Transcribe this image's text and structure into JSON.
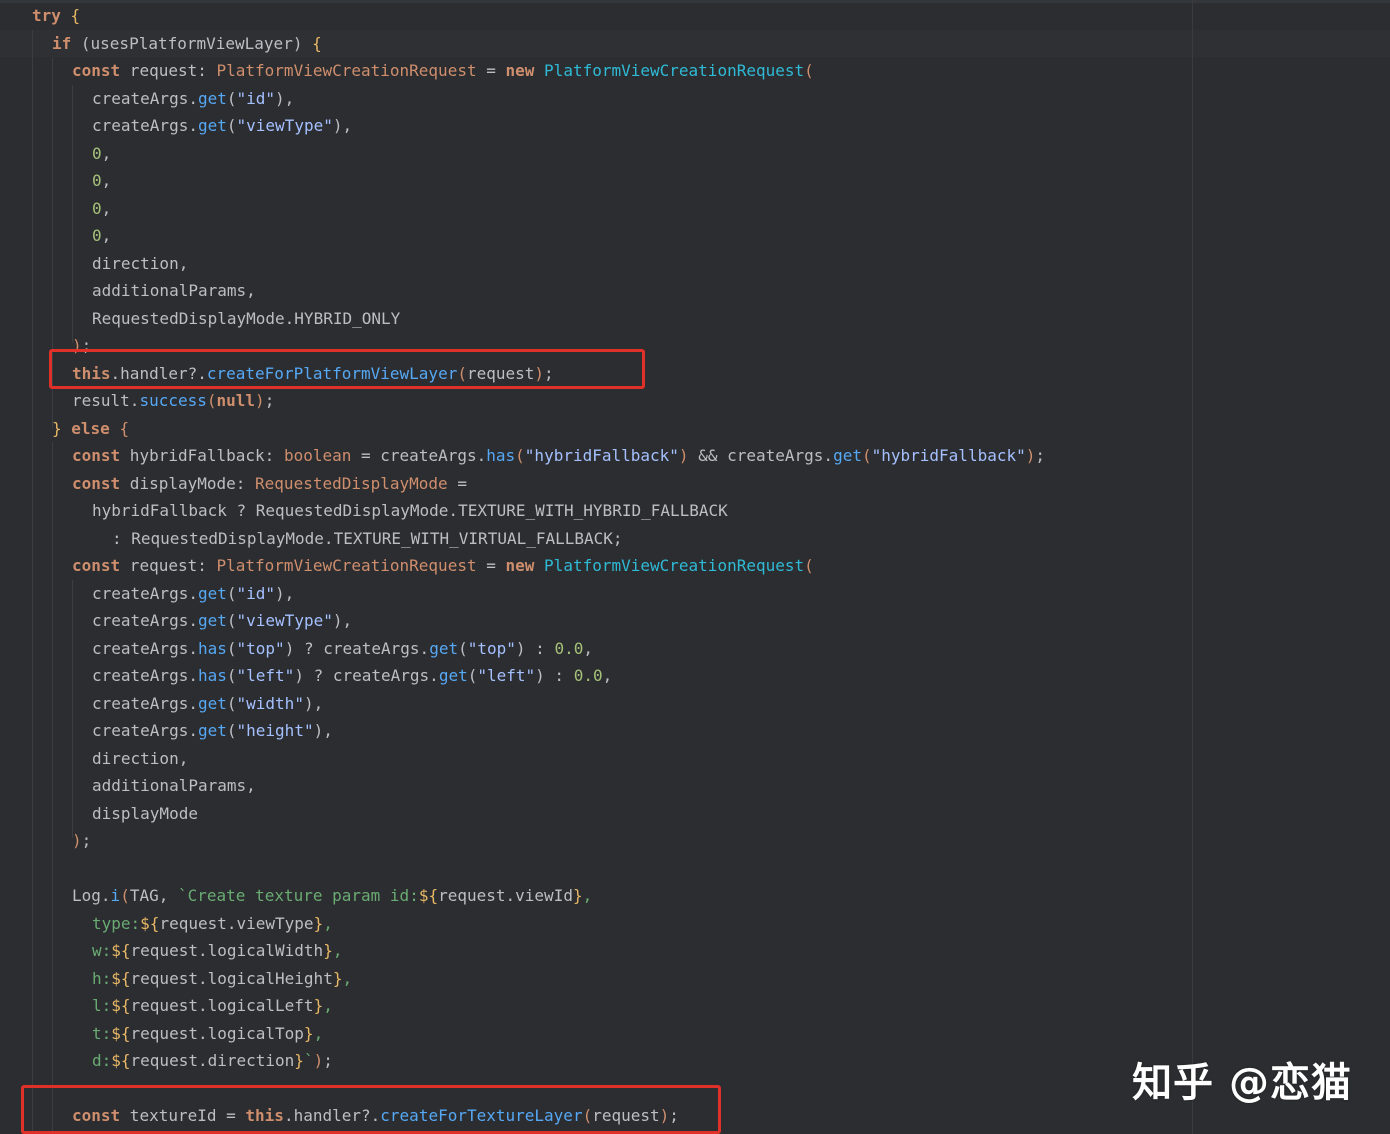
{
  "editor": {
    "colors": {
      "background": "#2b2d30",
      "keyword": "#cf8e6d",
      "type": "#c77dbb",
      "class": "#2fbad6",
      "method": "#56a8f5",
      "string": "#a5c0ff",
      "number": "#a6c17a",
      "highlight_box": "#e0302a"
    },
    "lines": [
      {
        "i": 0,
        "t": [
          [
            "kw",
            "try"
          ],
          [
            "pun",
            " "
          ],
          [
            "brk",
            "{"
          ]
        ]
      },
      {
        "i": 1,
        "t": [
          [
            "kw",
            "if"
          ],
          [
            "pun",
            " ("
          ],
          [
            "var",
            "usesPlatformViewLayer"
          ],
          [
            "pun",
            ") "
          ],
          [
            "brk",
            "{"
          ]
        ]
      },
      {
        "i": 2,
        "t": [
          [
            "kw",
            "const"
          ],
          [
            "var",
            " request"
          ],
          [
            "pun",
            ": "
          ],
          [
            "kwp",
            "PlatformViewCreationRequest"
          ],
          [
            "pun",
            " = "
          ],
          [
            "kw",
            "new"
          ],
          [
            "pun",
            " "
          ],
          [
            "cls",
            "PlatformViewCreationRequest"
          ],
          [
            "kwp",
            "("
          ]
        ]
      },
      {
        "i": 3,
        "t": [
          [
            "var",
            "createArgs"
          ],
          [
            "pun",
            "."
          ],
          [
            "fn",
            "get"
          ],
          [
            "pun",
            "("
          ],
          [
            "str",
            "\"id\""
          ],
          [
            "pun",
            "),"
          ]
        ]
      },
      {
        "i": 3,
        "t": [
          [
            "var",
            "createArgs"
          ],
          [
            "pun",
            "."
          ],
          [
            "fn",
            "get"
          ],
          [
            "pun",
            "("
          ],
          [
            "str",
            "\"viewType\""
          ],
          [
            "pun",
            "),"
          ]
        ]
      },
      {
        "i": 3,
        "t": [
          [
            "num",
            "0"
          ],
          [
            "pun",
            ","
          ]
        ]
      },
      {
        "i": 3,
        "t": [
          [
            "num",
            "0"
          ],
          [
            "pun",
            ","
          ]
        ]
      },
      {
        "i": 3,
        "t": [
          [
            "num",
            "0"
          ],
          [
            "pun",
            ","
          ]
        ]
      },
      {
        "i": 3,
        "t": [
          [
            "num",
            "0"
          ],
          [
            "pun",
            ","
          ]
        ]
      },
      {
        "i": 3,
        "t": [
          [
            "var",
            "direction"
          ],
          [
            "pun",
            ","
          ]
        ]
      },
      {
        "i": 3,
        "t": [
          [
            "var",
            "additionalParams"
          ],
          [
            "pun",
            ","
          ]
        ]
      },
      {
        "i": 3,
        "t": [
          [
            "var",
            "RequestedDisplayMode"
          ],
          [
            "pun",
            "."
          ],
          [
            "var",
            "HYBRID_ONLY"
          ]
        ]
      },
      {
        "i": 2,
        "t": [
          [
            "kwp",
            ")"
          ],
          [
            "pun",
            ";"
          ]
        ]
      },
      {
        "i": 2,
        "t": [
          [
            "kw",
            "this"
          ],
          [
            "pun",
            "."
          ],
          [
            "var",
            "handler"
          ],
          [
            "pun",
            "?."
          ],
          [
            "fn",
            "createForPlatformViewLayer"
          ],
          [
            "kwp",
            "("
          ],
          [
            "var",
            "request"
          ],
          [
            "kwp",
            ")"
          ],
          [
            "pun",
            ";"
          ]
        ]
      },
      {
        "i": 2,
        "t": [
          [
            "var",
            "result"
          ],
          [
            "pun",
            "."
          ],
          [
            "fn",
            "success"
          ],
          [
            "kwp",
            "("
          ],
          [
            "kw",
            "null"
          ],
          [
            "kwp",
            ")"
          ],
          [
            "pun",
            ";"
          ]
        ]
      },
      {
        "i": 1,
        "t": [
          [
            "brk",
            "}"
          ],
          [
            "pun",
            " "
          ],
          [
            "kw",
            "else"
          ],
          [
            "pun",
            " "
          ],
          [
            "kwp",
            "{"
          ]
        ]
      },
      {
        "i": 2,
        "t": [
          [
            "kw",
            "const"
          ],
          [
            "var",
            " hybridFallback"
          ],
          [
            "pun",
            ": "
          ],
          [
            "kwp",
            "boolean"
          ],
          [
            "pun",
            " = "
          ],
          [
            "var",
            "createArgs"
          ],
          [
            "pun",
            "."
          ],
          [
            "fn",
            "has"
          ],
          [
            "kwp",
            "("
          ],
          [
            "str",
            "\"hybridFallback\""
          ],
          [
            "kwp",
            ")"
          ],
          [
            "pun",
            " && "
          ],
          [
            "var",
            "createArgs"
          ],
          [
            "pun",
            "."
          ],
          [
            "fn",
            "get"
          ],
          [
            "kwp",
            "("
          ],
          [
            "str",
            "\"hybridFallback\""
          ],
          [
            "kwp",
            ")"
          ],
          [
            "pun",
            ";"
          ]
        ]
      },
      {
        "i": 2,
        "t": [
          [
            "kw",
            "const"
          ],
          [
            "var",
            " displayMode"
          ],
          [
            "pun",
            ": "
          ],
          [
            "kwp",
            "RequestedDisplayMode"
          ],
          [
            "pun",
            " ="
          ]
        ]
      },
      {
        "i": 3,
        "t": [
          [
            "var",
            "hybridFallback"
          ],
          [
            "pun",
            " ? "
          ],
          [
            "var",
            "RequestedDisplayMode"
          ],
          [
            "pun",
            "."
          ],
          [
            "var",
            "TEXTURE_WITH_HYBRID_FALLBACK"
          ]
        ]
      },
      {
        "i": 4,
        "t": [
          [
            "pun",
            ": "
          ],
          [
            "var",
            "RequestedDisplayMode"
          ],
          [
            "pun",
            "."
          ],
          [
            "var",
            "TEXTURE_WITH_VIRTUAL_FALLBACK"
          ],
          [
            "pun",
            ";"
          ]
        ]
      },
      {
        "i": 2,
        "t": [
          [
            "kw",
            "const"
          ],
          [
            "var",
            " request"
          ],
          [
            "pun",
            ": "
          ],
          [
            "kwp",
            "PlatformViewCreationRequest"
          ],
          [
            "pun",
            " = "
          ],
          [
            "kw",
            "new"
          ],
          [
            "pun",
            " "
          ],
          [
            "cls",
            "PlatformViewCreationRequest"
          ],
          [
            "kwp",
            "("
          ]
        ]
      },
      {
        "i": 3,
        "t": [
          [
            "var",
            "createArgs"
          ],
          [
            "pun",
            "."
          ],
          [
            "fn",
            "get"
          ],
          [
            "pun",
            "("
          ],
          [
            "str",
            "\"id\""
          ],
          [
            "pun",
            "),"
          ]
        ]
      },
      {
        "i": 3,
        "t": [
          [
            "var",
            "createArgs"
          ],
          [
            "pun",
            "."
          ],
          [
            "fn",
            "get"
          ],
          [
            "pun",
            "("
          ],
          [
            "str",
            "\"viewType\""
          ],
          [
            "pun",
            "),"
          ]
        ]
      },
      {
        "i": 3,
        "t": [
          [
            "var",
            "createArgs"
          ],
          [
            "pun",
            "."
          ],
          [
            "fn",
            "has"
          ],
          [
            "pun",
            "("
          ],
          [
            "str",
            "\"top\""
          ],
          [
            "pun",
            ") ? "
          ],
          [
            "var",
            "createArgs"
          ],
          [
            "pun",
            "."
          ],
          [
            "fn",
            "get"
          ],
          [
            "pun",
            "("
          ],
          [
            "str",
            "\"top\""
          ],
          [
            "pun",
            ") : "
          ],
          [
            "num",
            "0.0"
          ],
          [
            "pun",
            ","
          ]
        ]
      },
      {
        "i": 3,
        "t": [
          [
            "var",
            "createArgs"
          ],
          [
            "pun",
            "."
          ],
          [
            "fn",
            "has"
          ],
          [
            "pun",
            "("
          ],
          [
            "str",
            "\"left\""
          ],
          [
            "pun",
            ") ? "
          ],
          [
            "var",
            "createArgs"
          ],
          [
            "pun",
            "."
          ],
          [
            "fn",
            "get"
          ],
          [
            "pun",
            "("
          ],
          [
            "str",
            "\"left\""
          ],
          [
            "pun",
            ") : "
          ],
          [
            "num",
            "0.0"
          ],
          [
            "pun",
            ","
          ]
        ]
      },
      {
        "i": 3,
        "t": [
          [
            "var",
            "createArgs"
          ],
          [
            "pun",
            "."
          ],
          [
            "fn",
            "get"
          ],
          [
            "pun",
            "("
          ],
          [
            "str",
            "\"width\""
          ],
          [
            "pun",
            "),"
          ]
        ]
      },
      {
        "i": 3,
        "t": [
          [
            "var",
            "createArgs"
          ],
          [
            "pun",
            "."
          ],
          [
            "fn",
            "get"
          ],
          [
            "pun",
            "("
          ],
          [
            "str",
            "\"height\""
          ],
          [
            "pun",
            "),"
          ]
        ]
      },
      {
        "i": 3,
        "t": [
          [
            "var",
            "direction"
          ],
          [
            "pun",
            ","
          ]
        ]
      },
      {
        "i": 3,
        "t": [
          [
            "var",
            "additionalParams"
          ],
          [
            "pun",
            ","
          ]
        ]
      },
      {
        "i": 3,
        "t": [
          [
            "var",
            "displayMode"
          ]
        ]
      },
      {
        "i": 2,
        "t": [
          [
            "kwp",
            ")"
          ],
          [
            "pun",
            ";"
          ]
        ]
      },
      {
        "i": 2,
        "t": []
      },
      {
        "i": 2,
        "t": [
          [
            "var",
            "Log"
          ],
          [
            "pun",
            "."
          ],
          [
            "fn",
            "i"
          ],
          [
            "kwp",
            "("
          ],
          [
            "var",
            "TAG"
          ],
          [
            "pun",
            ", "
          ],
          [
            "tpl",
            "`Create texture param id:"
          ],
          [
            "brk",
            "${"
          ],
          [
            "var",
            "request.viewId"
          ],
          [
            "brk",
            "}"
          ],
          [
            "tpl",
            ","
          ]
        ]
      },
      {
        "i": 3,
        "t": [
          [
            "tpl",
            "type:"
          ],
          [
            "brk",
            "${"
          ],
          [
            "var",
            "request.viewType"
          ],
          [
            "brk",
            "}"
          ],
          [
            "tpl",
            ","
          ]
        ]
      },
      {
        "i": 3,
        "t": [
          [
            "tpl",
            "w:"
          ],
          [
            "brk",
            "${"
          ],
          [
            "var",
            "request.logicalWidth"
          ],
          [
            "brk",
            "}"
          ],
          [
            "tpl",
            ","
          ]
        ]
      },
      {
        "i": 3,
        "t": [
          [
            "tpl",
            "h:"
          ],
          [
            "brk",
            "${"
          ],
          [
            "var",
            "request.logicalHeight"
          ],
          [
            "brk",
            "}"
          ],
          [
            "tpl",
            ","
          ]
        ]
      },
      {
        "i": 3,
        "t": [
          [
            "tpl",
            "l:"
          ],
          [
            "brk",
            "${"
          ],
          [
            "var",
            "request.logicalLeft"
          ],
          [
            "brk",
            "}"
          ],
          [
            "tpl",
            ","
          ]
        ]
      },
      {
        "i": 3,
        "t": [
          [
            "tpl",
            "t:"
          ],
          [
            "brk",
            "${"
          ],
          [
            "var",
            "request.logicalTop"
          ],
          [
            "brk",
            "}"
          ],
          [
            "tpl",
            ","
          ]
        ]
      },
      {
        "i": 3,
        "t": [
          [
            "tpl",
            "d:"
          ],
          [
            "brk",
            "${"
          ],
          [
            "var",
            "request.direction"
          ],
          [
            "brk",
            "}"
          ],
          [
            "tpl",
            "`"
          ],
          [
            "kwp",
            ")"
          ],
          [
            "pun",
            ";"
          ]
        ]
      },
      {
        "i": 2,
        "t": []
      },
      {
        "i": 2,
        "t": [
          [
            "kw",
            "const"
          ],
          [
            "var",
            " textureId"
          ],
          [
            "pun",
            " = "
          ],
          [
            "kw",
            "this"
          ],
          [
            "pun",
            "."
          ],
          [
            "var",
            "handler"
          ],
          [
            "pun",
            "?."
          ],
          [
            "fn",
            "createForTextureLayer"
          ],
          [
            "kwp",
            "("
          ],
          [
            "var",
            "request"
          ],
          [
            "kwp",
            ")"
          ],
          [
            "pun",
            ";"
          ]
        ]
      }
    ]
  },
  "watermark": {
    "text": "知乎 @恋猫"
  }
}
